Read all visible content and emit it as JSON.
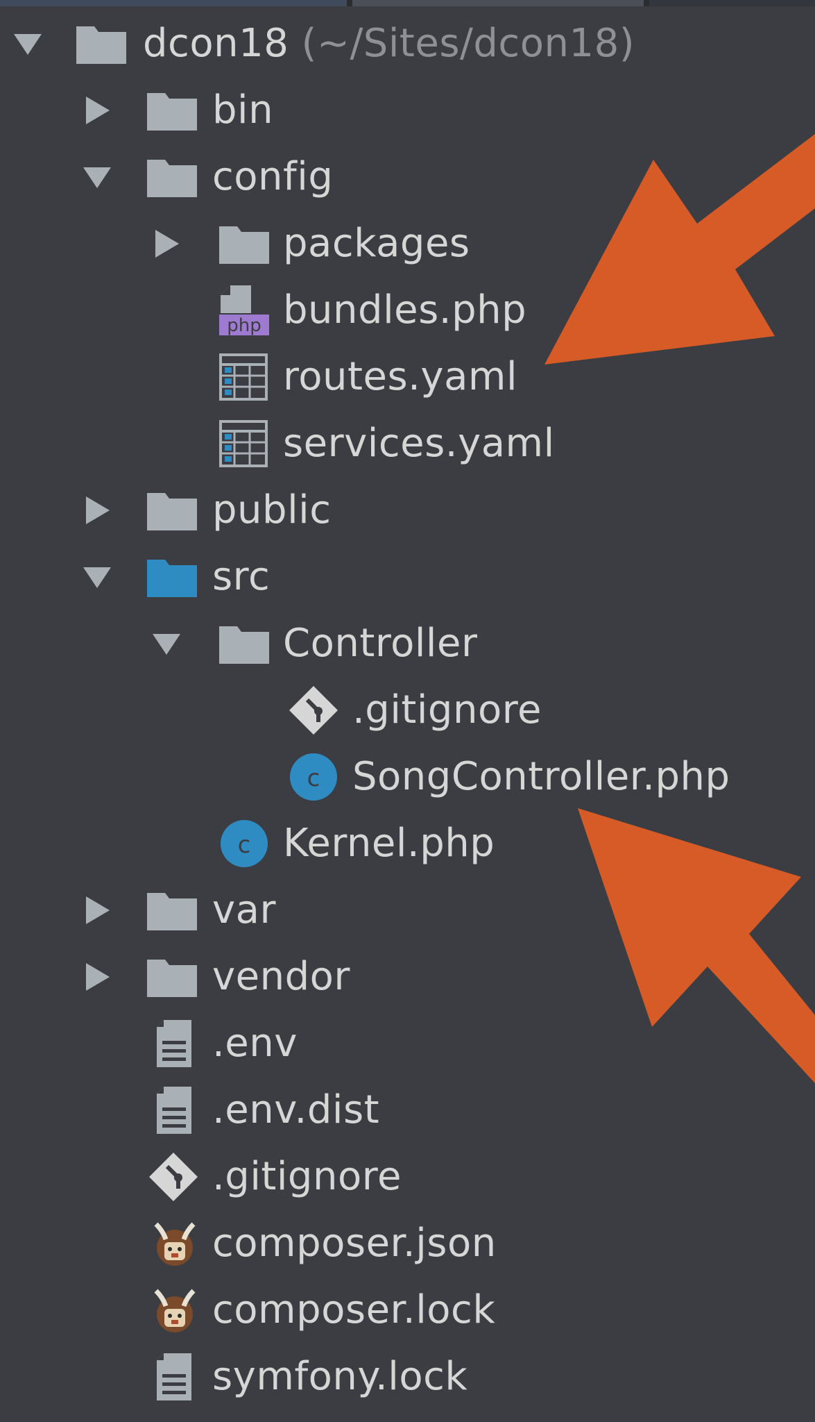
{
  "colors": {
    "background": "#3c3d42",
    "text": "#d6d6d6",
    "muted_path": "#8f9094",
    "folder": "#a9b0b6",
    "source_folder": "#2e8cc2",
    "php_badge": "#9e7bd0",
    "class_icon": "#2e8cc2",
    "callout_arrow": "#d75b26"
  },
  "tree": {
    "root": {
      "name": "dcon18",
      "path": "(~/Sites/dcon18)",
      "expanded": true,
      "icon": "folder-icon"
    },
    "items": [
      {
        "id": "bin",
        "label": "bin",
        "icon": "folder-icon",
        "toggle": "collapsed"
      },
      {
        "id": "config",
        "label": "config",
        "icon": "folder-icon",
        "toggle": "expanded"
      },
      {
        "id": "packages",
        "label": "packages",
        "icon": "folder-icon",
        "toggle": "collapsed"
      },
      {
        "id": "bundles-php",
        "label": "bundles.php",
        "icon": "php-file-icon",
        "badge": "php"
      },
      {
        "id": "routes-yaml",
        "label": "routes.yaml",
        "icon": "yaml-file-icon"
      },
      {
        "id": "services-yaml",
        "label": "services.yaml",
        "icon": "yaml-file-icon"
      },
      {
        "id": "public",
        "label": "public",
        "icon": "folder-icon",
        "toggle": "collapsed"
      },
      {
        "id": "src",
        "label": "src",
        "icon": "source-folder-icon",
        "toggle": "expanded"
      },
      {
        "id": "controller",
        "label": "Controller",
        "icon": "folder-icon",
        "toggle": "expanded"
      },
      {
        "id": "controller-gitignore",
        "label": ".gitignore",
        "icon": "git-icon"
      },
      {
        "id": "song-controller",
        "label": "SongController.php",
        "icon": "php-class-icon",
        "class_glyph": "c"
      },
      {
        "id": "kernel",
        "label": "Kernel.php",
        "icon": "php-class-icon",
        "class_glyph": "c"
      },
      {
        "id": "var",
        "label": "var",
        "icon": "folder-icon",
        "toggle": "collapsed"
      },
      {
        "id": "vendor",
        "label": "vendor",
        "icon": "folder-icon",
        "toggle": "collapsed"
      },
      {
        "id": "env",
        "label": ".env",
        "icon": "text-file-icon"
      },
      {
        "id": "env-dist",
        "label": ".env.dist",
        "icon": "text-file-icon"
      },
      {
        "id": "root-gitignore",
        "label": ".gitignore",
        "icon": "git-icon"
      },
      {
        "id": "composer-json",
        "label": "composer.json",
        "icon": "composer-icon"
      },
      {
        "id": "composer-lock",
        "label": "composer.lock",
        "icon": "composer-icon"
      },
      {
        "id": "symfony-lock",
        "label": "symfony.lock",
        "icon": "text-file-icon"
      }
    ]
  }
}
